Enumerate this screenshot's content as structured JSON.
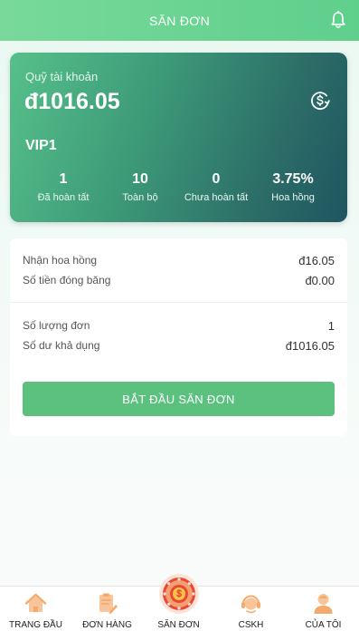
{
  "header": {
    "title": "SĂN ĐƠN",
    "icon": "bell-icon"
  },
  "fund": {
    "label": "Quỹ tài khoản",
    "amount": "đ1016.05",
    "icon": "dollar-circle-icon",
    "vip": "VIP1",
    "stats": [
      {
        "value": "1",
        "label": "Đã hoàn tất"
      },
      {
        "value": "10",
        "label": "Toàn bộ"
      },
      {
        "value": "0",
        "label": "Chưa hoàn tất"
      },
      {
        "value": "3.75%",
        "label": "Hoa hồng"
      }
    ]
  },
  "info": {
    "rows": [
      {
        "label": "Nhận hoa hồng",
        "value": "đ16.05"
      },
      {
        "label": "Số tiền đóng băng",
        "value": "đ0.00"
      },
      {
        "label": "Số lượng đơn",
        "value": "1"
      },
      {
        "label": "Số dư khả dụng",
        "value": "đ1016.05"
      }
    ],
    "button_label": "BẮT ĐẦU SĂN ĐƠN"
  },
  "tabbar": {
    "items": [
      {
        "label": "TRANG ĐẦU",
        "icon": "home-icon"
      },
      {
        "label": "ĐƠN HÀNG",
        "icon": "order-icon"
      },
      {
        "label": "SĂN ĐƠN",
        "icon": "lucky-wheel-icon"
      },
      {
        "label": "CSKH",
        "icon": "support-icon"
      },
      {
        "label": "CỦA TÔI",
        "icon": "user-icon"
      }
    ]
  },
  "colors": {
    "primary": "#5cc07f",
    "icon_orange": "#f5a96a",
    "wheel_red": "#e9473a"
  }
}
